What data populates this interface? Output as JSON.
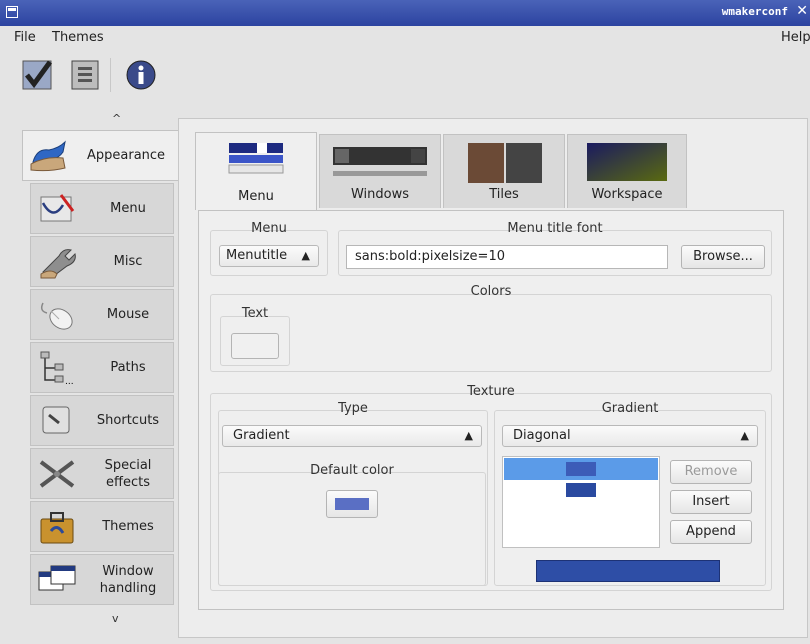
{
  "window": {
    "title": "wmakerconf",
    "close_glyph": "✕"
  },
  "menubar": {
    "file": "File",
    "themes": "Themes",
    "help": "Help"
  },
  "toolbar": {
    "apply_icon": "checkmark-icon",
    "revert_icon": "document-icon",
    "info_icon": "info-icon"
  },
  "sidebar": {
    "up_arrow": "^",
    "down_arrow": "v",
    "items": [
      {
        "label": "Appearance",
        "icon": "appearance-hand-icon"
      },
      {
        "label": "Menu",
        "icon": "menu-stethoscope-icon"
      },
      {
        "label": "Misc",
        "icon": "misc-wrench-icon"
      },
      {
        "label": "Mouse",
        "icon": "mouse-icon"
      },
      {
        "label": "Paths",
        "icon": "paths-tree-icon"
      },
      {
        "label": "Shortcuts",
        "icon": "shortcuts-icon"
      },
      {
        "label": "Special effects",
        "icon": "special-effects-icon"
      },
      {
        "label": "Themes",
        "icon": "themes-briefcase-icon"
      },
      {
        "label": "Window handling",
        "icon": "window-handling-icon"
      }
    ]
  },
  "tabs": [
    {
      "label": "Menu",
      "active": true
    },
    {
      "label": "Windows",
      "active": false
    },
    {
      "label": "Tiles",
      "active": false
    },
    {
      "label": "Workspace",
      "active": false
    }
  ],
  "menu_group": {
    "title": "Menu",
    "selected": "Menutitle"
  },
  "font_group": {
    "title": "Menu title font",
    "value": "sans:bold:pixelsize=10",
    "browse_label": "Browse..."
  },
  "colors_group": {
    "title": "Colors",
    "text_label": "Text",
    "text_color": "#f0f0f0"
  },
  "texture_group": {
    "title": "Texture",
    "type_title": "Type",
    "type_selected": "Gradient",
    "default_color_title": "Default color",
    "default_color": "#5a6fc4",
    "gradient_title": "Gradient",
    "gradient_selected": "Diagonal",
    "remove_label": "Remove",
    "insert_label": "Insert",
    "append_label": "Append",
    "gradient_colors": [
      "#3c5cb8",
      "#2a4aa0"
    ],
    "preview_color": "#2e4ea6"
  },
  "colors": {
    "titlebar": "#2f47a4",
    "selection": "#5b9be8"
  }
}
